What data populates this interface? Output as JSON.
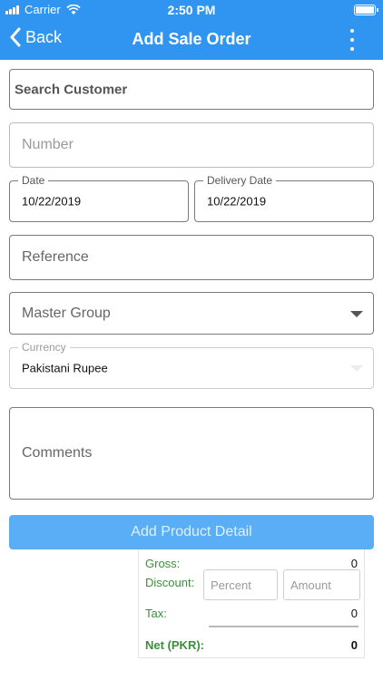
{
  "status": {
    "carrier": "Carrier",
    "time": "2:50 PM"
  },
  "nav": {
    "back_label": "Back",
    "title": "Add Sale Order"
  },
  "form": {
    "search_customer_placeholder": "Search Customer",
    "number_placeholder": "Number",
    "date_label": "Date",
    "date_value": "10/22/2019",
    "delivery_date_label": "Delivery Date",
    "delivery_date_value": "10/22/2019",
    "reference_placeholder": "Reference",
    "master_group_placeholder": "Master Group",
    "currency_label": "Currency",
    "currency_value": "Pakistani Rupee",
    "comments_placeholder": "Comments"
  },
  "add_product_label": "Add Product Detail",
  "summary": {
    "gross_label": "Gross:",
    "gross_value": "0",
    "discount_label": "Discount:",
    "percent_placeholder": "Percent",
    "amount_placeholder": "Amount",
    "tax_label": "Tax:",
    "tax_value": "0",
    "net_label": "Net (PKR):",
    "net_value": "0"
  },
  "colors": {
    "header": "#2f95f0",
    "button": "#5aaef5",
    "summary_label": "#3b8e3b"
  },
  "icons": [
    "signal-icon",
    "wifi-icon",
    "battery-icon",
    "back-chevron-icon",
    "more-vertical-icon",
    "dropdown-caret-icon"
  ]
}
